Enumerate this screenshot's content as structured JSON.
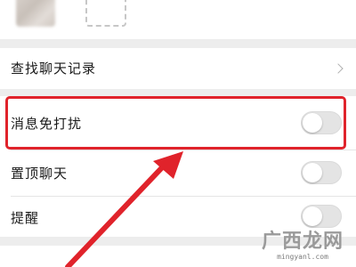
{
  "header": {
    "avatar_icon": "blurred-avatar",
    "add_member_icon": "add-dashed-icon"
  },
  "settings": {
    "search_history": {
      "label": "查找聊天记录",
      "icon": "chevron-right-icon"
    },
    "mute_notifications": {
      "label": "消息免打扰",
      "enabled": false
    },
    "sticky_on_top": {
      "label": "置顶聊天",
      "enabled": false
    },
    "remind": {
      "label": "提醒",
      "enabled": false
    }
  },
  "annotation": {
    "color": "#e0232b"
  },
  "watermark": {
    "name": "广西龙网",
    "url": "mingyanl.com"
  }
}
